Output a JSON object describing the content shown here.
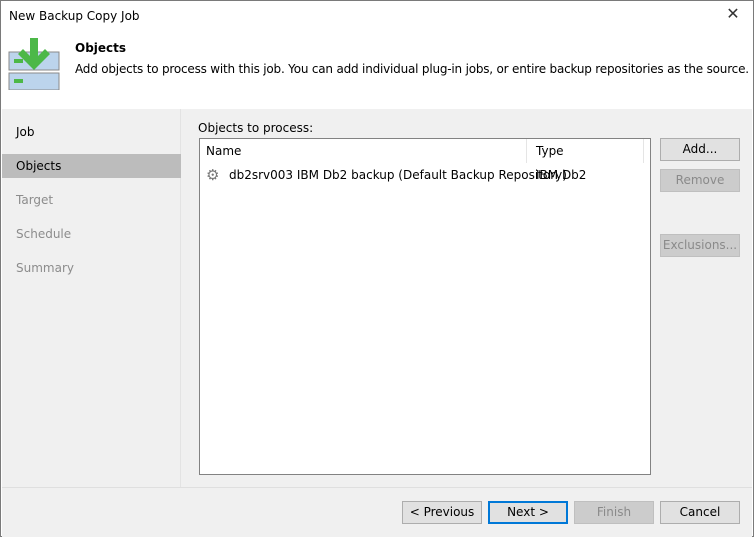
{
  "window": {
    "title": "New Backup Copy Job"
  },
  "header": {
    "title": "Objects",
    "description": "Add objects to process with this job. You can add individual plug-in jobs, or entire backup repositories as the source."
  },
  "nav": {
    "items": [
      "Job",
      "Objects",
      "Target",
      "Schedule",
      "Summary"
    ]
  },
  "objects": {
    "label": "Objects to process:",
    "columns": [
      "Name",
      "Type"
    ],
    "rows": [
      {
        "name": "db2srv003 IBM Db2 backup (Default Backup Repository)",
        "type": "IBM Db2",
        "icon": "gear-icon"
      }
    ]
  },
  "side_buttons": {
    "add": "Add...",
    "remove": "Remove",
    "exclusions": "Exclusions..."
  },
  "footer": {
    "previous": "< Previous",
    "next": "Next >",
    "finish": "Finish",
    "cancel": "Cancel"
  }
}
